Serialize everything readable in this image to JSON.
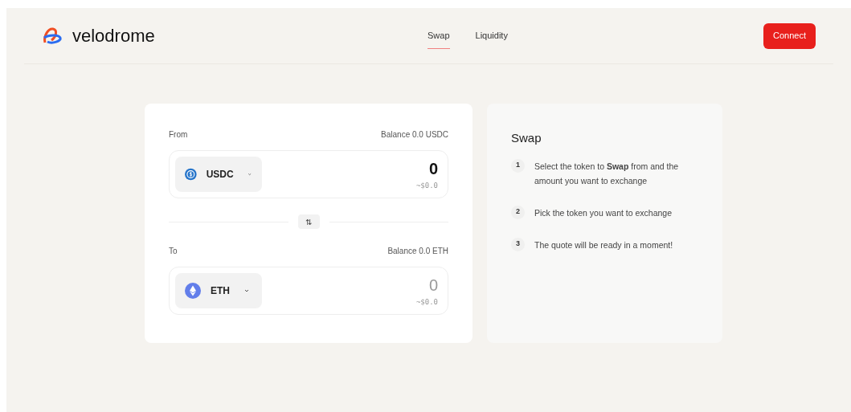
{
  "logo": {
    "text": "velodrome"
  },
  "nav": [
    {
      "label": "Swap",
      "selected": true
    },
    {
      "label": "Liquidity",
      "selected": false
    }
  ],
  "connect_button": "Connect",
  "swap_form": {
    "sections": [
      {
        "label": "From",
        "balance": "Balance 0.0 USDC",
        "token": "USDC",
        "kind": "usdc",
        "amount": {
          "value": "0"
        },
        "usd": "~$0.0"
      },
      {
        "label": "To",
        "balance": "Balance 0.0 ETH",
        "token": "ETH",
        "kind": "eth",
        "amount": {
          "placeholder": "0"
        },
        "usd": "~$0.0"
      }
    ],
    "switch_button": "⇅"
  },
  "help": {
    "title": "Swap",
    "steps": [
      {
        "number": "1",
        "text": "Select the token to **Swap** from and the amount you want to exchange"
      },
      {
        "number": "2",
        "text": "Pick the token you want to exchange"
      },
      {
        "number": "3",
        "text": "The quote will be ready in a moment!"
      }
    ]
  }
}
